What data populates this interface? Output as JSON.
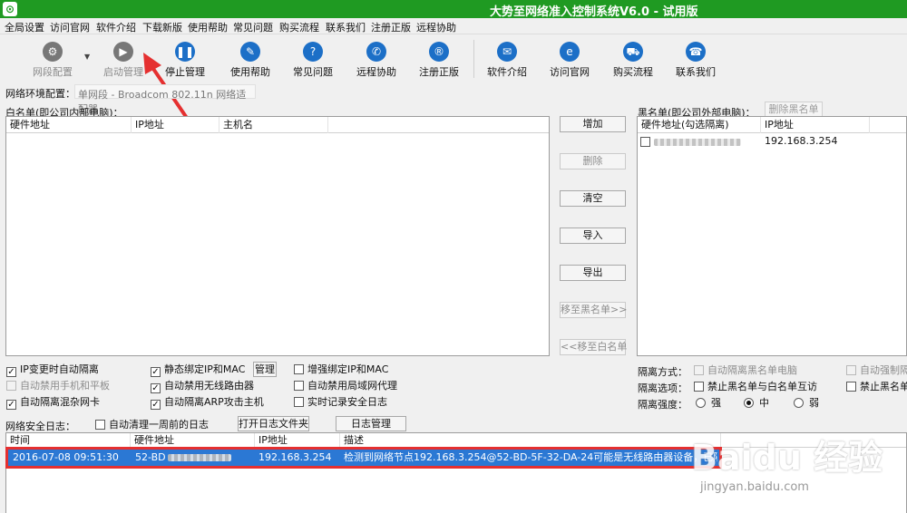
{
  "window": {
    "title": "大势至网络准入控制系统V6.0 - 试用版"
  },
  "menu": [
    "全局设置",
    "访问官网",
    "软件介绍",
    "下载新版",
    "使用帮助",
    "常见问题",
    "购买流程",
    "联系我们",
    "注册正版",
    "远程协助"
  ],
  "toolbar": {
    "network_config": "网段配置",
    "start": "启动管理",
    "stop": "停止管理",
    "help": "使用帮助",
    "faq": "常见问题",
    "remote": "远程协助",
    "register": "注册正版",
    "intro": "软件介绍",
    "website": "访问官网",
    "buy": "购买流程",
    "contact": "联系我们"
  },
  "env": {
    "label": "网络环境配置：",
    "value": "单网段 - Broadcom 802.11n 网络适配器"
  },
  "whitelist": {
    "title": "白名单(即公司内部电脑)：",
    "columns": [
      "硬件地址",
      "IP地址",
      "主机名"
    ]
  },
  "actions": {
    "add": "增加",
    "delete": "删除",
    "clear": "清空",
    "import": "导入",
    "export": "导出",
    "to_black": "移至黑名单>>",
    "to_white": "<<移至白名单"
  },
  "blacklist": {
    "title": "黑名单(即公司外部电脑)：",
    "delete_btn": "删除黑名单",
    "columns": [
      "硬件地址(勾选隔离)",
      "IP地址"
    ],
    "rows": [
      {
        "ip": "192.168.3.254"
      }
    ]
  },
  "options": {
    "ip_change_isolate": "IP变更时自动隔离",
    "disable_phone": "自动禁用手机和平板",
    "isolate_nic": "自动隔离混杂网卡",
    "static_bind": "静态绑定IP和MAC",
    "manage": "管理",
    "disable_router": "自动禁用无线路由器",
    "isolate_arp": "自动隔离ARP攻击主机",
    "enhanced_bind": "增强绑定IP和MAC",
    "disable_proxy": "自动禁用局域网代理",
    "realtime_log": "实时记录安全日志"
  },
  "isolation": {
    "mode_label": "隔离方式：",
    "mode_black": "自动隔离黑名单电脑",
    "mode_forced": "自动强制隔",
    "options_label": "隔离选项：",
    "no_mutual": "禁止黑名单与白名单互访",
    "no_black": "禁止黑名单",
    "strength_label": "隔离强度：",
    "strong": "强",
    "medium": "中",
    "weak": "弱"
  },
  "log": {
    "label": "网络安全日志：",
    "auto_clean": "自动清理一周前的日志",
    "open_folder": "打开日志文件夹",
    "manage": "日志管理",
    "columns": [
      "时间",
      "硬件地址",
      "IP地址",
      "描述"
    ],
    "row": {
      "time": "2016-07-08 09:51:30",
      "mac_prefix": "52-BD",
      "ip": "192.168.3.254",
      "desc": "检测到网络节点192.168.3.254@52-BD-5F-32-DA-24可能是无线路由器设备，已隔离"
    }
  },
  "watermark": {
    "logo": "Baidu 经验",
    "url": "jingyan.baidu.com"
  },
  "colors": {
    "titlebar": "#1f9a22",
    "selection": "#2b78d4",
    "highlight_border": "#e53030",
    "arrow": "#e53030"
  }
}
